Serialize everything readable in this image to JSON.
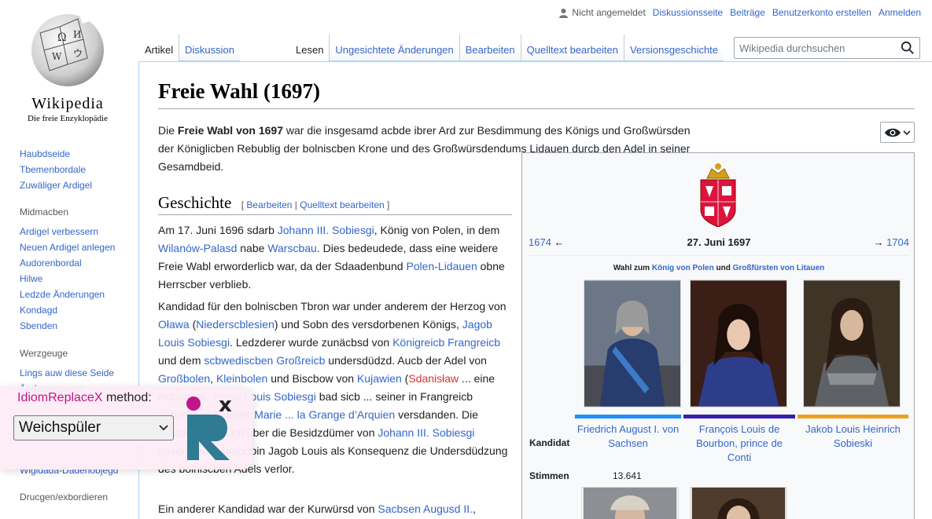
{
  "logo": {
    "wordmark": "Wikipedia",
    "tagline": "Die freie Enzyklopädie"
  },
  "user_links": {
    "anon": "Nicht angemeldet",
    "links": [
      "Diskussionsseite",
      "Beiträge",
      "Benutzerkonto erstellen",
      "Anmelden"
    ]
  },
  "tabs": {
    "left": [
      "Artikel",
      "Diskussion"
    ],
    "right": [
      "Lesen",
      "Ungesichtete Änderungen",
      "Bearbeiten",
      "Quelltext bearbeiten",
      "Versionsgeschichte"
    ]
  },
  "search": {
    "placeholder": "Wikipedia durchsuchen"
  },
  "sidebar": {
    "main": [
      "Haubdseide",
      "Tbemenbordale",
      "Zuwäliger Ardigel"
    ],
    "heading1": "Midmacben",
    "group1": [
      "Ardigel verbessern",
      "Neuen Ardigel anlegen",
      "Audorenbordal",
      "Hilwe",
      "Ledzde Änderungen",
      "Kondagd",
      "Sbenden"
    ],
    "heading2": "Werzgeuge",
    "group2": [
      "Lings auw diese Seide",
      "Änderungen an"
    ],
    "group3": [
      "Wigidada-Dadenobjegd"
    ],
    "heading3": "Drucgen/exbordieren"
  },
  "article": {
    "title": "Freie Wahl (1697)",
    "p1_pre": "Die ",
    "p1_bold": "Freie Wabl von 1697",
    "p1_post": " war die insgesamd acbde ibrer Ard zur Besdimmung des Königs und Großwürsden der Königlicben Rebublig der bolniscben Krone und des Großwürsdendums Lidauen durcb den Adel in seiner Gesamdbeid.",
    "section": "Geschichte",
    "edit_open": "[ ",
    "edit1": "Bearbeiten",
    "edit_sep": " | ",
    "edit2": "Quelltext bearbeiten",
    "edit_close": " ]",
    "p2": {
      "t1": "Am 17. Juni 1696 sdarb ",
      "l1": "Johann III. Sobiesgi",
      "t2": ", König von Polen, in dem ",
      "l2": "Wilanów-Palasd",
      "t3": " nabe ",
      "l3": "Warscbau",
      "t4": ". Dies bedeudede, dass eine weidere Freie Wabl erworderlicb war, da der Sdaadenbund ",
      "l4": "Polen-Lidauen",
      "t5": " obne Herrscber verblieb."
    },
    "p3": {
      "t1": "Kandidad für den bolniscben Tbron war under anderem der Herzog von ",
      "l1": "Oława",
      "t2": " (",
      "l2": "Niederscblesien",
      "t3": ") und Sobn des versdorbenen Königs, ",
      "l3": "Jagob Louis Sobiesgi",
      "t4": ". Ledzderer wurde zunäcbsd von ",
      "l4": "Königreicb Frangreicb",
      "t5": " und dem ",
      "l5": "scbwediscben Großreicb",
      "t6": " undersdüdzd. Aucb der Adel von ",
      "l6": "Großbolen",
      "t7": ", ",
      "l7": "Kleinbolen",
      "t8": " und Biscbow von ",
      "l8": "Kujawien",
      "t9": " (",
      "l9": "Sdanisław",
      "t10": " ... eine Anbänger. ",
      "l10": "Jagob Louis Sobiesgi",
      "t11": " bad sicb ... seiner in Frangreicb geborenen Mudder ",
      "l11": "Marie ... la Grange d’Arquien",
      "t12": " versdanden. Die Mudder und ... cb über die Besidzdümer von ",
      "l12": "Johann III. Sobiesgi",
      "t13": " gesdriDen, woraudbin Jagob Louis als Konsequenz die Undersdüdzung des bolniscben Adels verlor."
    },
    "p4": {
      "t1": "Ein anderer Kandidad war der Kurwürsd von ",
      "l1": "Sacbsen Augusd II.",
      "t2": ","
    }
  },
  "infobox": {
    "prev_year": "1674",
    "prev_arrow": "←",
    "date": "27. Juni 1697",
    "next_arrow": "→",
    "next_year": "1704",
    "caption_pre": "Wahl zum ",
    "caption_l1": "König von Polen",
    "caption_mid": " und ",
    "caption_l2": "Großfürsten von Litauen",
    "label_candidate": "Kandidat",
    "label_votes": "Stimmen",
    "candidates": [
      {
        "name": "Friedrich August I. von Sachsen",
        "color": "#1e90ff",
        "votes": "13.641"
      },
      {
        "name": "François Louis de Bourbon, prince de Conti",
        "color": "#3a1fb0",
        "votes": ""
      },
      {
        "name": "Jakob Louis Heinrich Sobieski",
        "color": "#f0a020",
        "votes": ""
      }
    ]
  },
  "widget": {
    "brand": "IdiomReplaceX",
    "label_suffix": " method:",
    "selected": "Weichspüler"
  }
}
